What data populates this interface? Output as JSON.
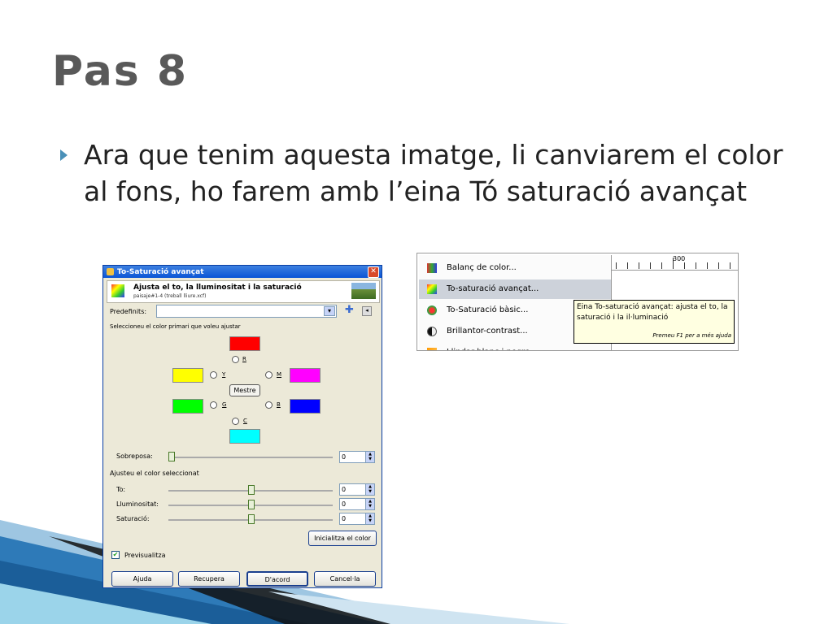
{
  "slide": {
    "title": "Pas 8",
    "bullet": "Ara que tenim aquesta imatge, li canviarem el color al fons, ho farem amb l’eina Tó saturació avançat"
  },
  "dialog": {
    "title": "To-Saturació avançat",
    "header_title": "Ajusta el to, la lluminositat i la saturació",
    "header_subtitle": "paisaje#1-4 (treball lliure.xcf)",
    "predefinits_label": "Predefinits:",
    "select_primary_label": "Seleccioneu el color primari que voleu ajustar",
    "radio_r": "R",
    "radio_y": "Y",
    "radio_m": "M",
    "master_button": "Mestre",
    "radio_g": "G",
    "radio_b": "B",
    "radio_c": "C",
    "overlap_label": "Sobreposa:",
    "overlap_value": "0",
    "adjust_selected_label": "Ajusteu el color seleccionat",
    "hue_label": "To:",
    "hue_value": "0",
    "lightness_label": "Lluminositat:",
    "lightness_value": "0",
    "saturation_label": "Saturació:",
    "saturation_value": "0",
    "reset_color_button": "Inicialitza el color",
    "preview_label": "Previsualitza",
    "help_button": "Ajuda",
    "reset_button": "Recupera",
    "ok_button": "D'acord",
    "cancel_button": "Cancel·la",
    "colors": {
      "red": "#ff0000",
      "yellow": "#ffff00",
      "magenta": "#ff00ff",
      "green": "#00ff00",
      "blue": "#0000ff",
      "cyan": "#00ffff"
    }
  },
  "menu": {
    "items": [
      {
        "label": "Balanç de color...",
        "icon": "color-balance-icon"
      },
      {
        "label": "To-saturació avançat...",
        "icon": "hue-saturation-icon"
      },
      {
        "label": "To-Saturació bàsic...",
        "icon": "colorize-icon"
      },
      {
        "label": "Brillantor-contrast...",
        "icon": "brightness-contrast-icon"
      },
      {
        "label": "Llindar blanc i negre...",
        "icon": "threshold-icon"
      }
    ],
    "ruler_label": "300",
    "tooltip_text": "Eina To-saturació avançat: ajusta el to, la saturació i la il·luminació",
    "tooltip_help": "Premeu F1 per a més ajuda"
  }
}
